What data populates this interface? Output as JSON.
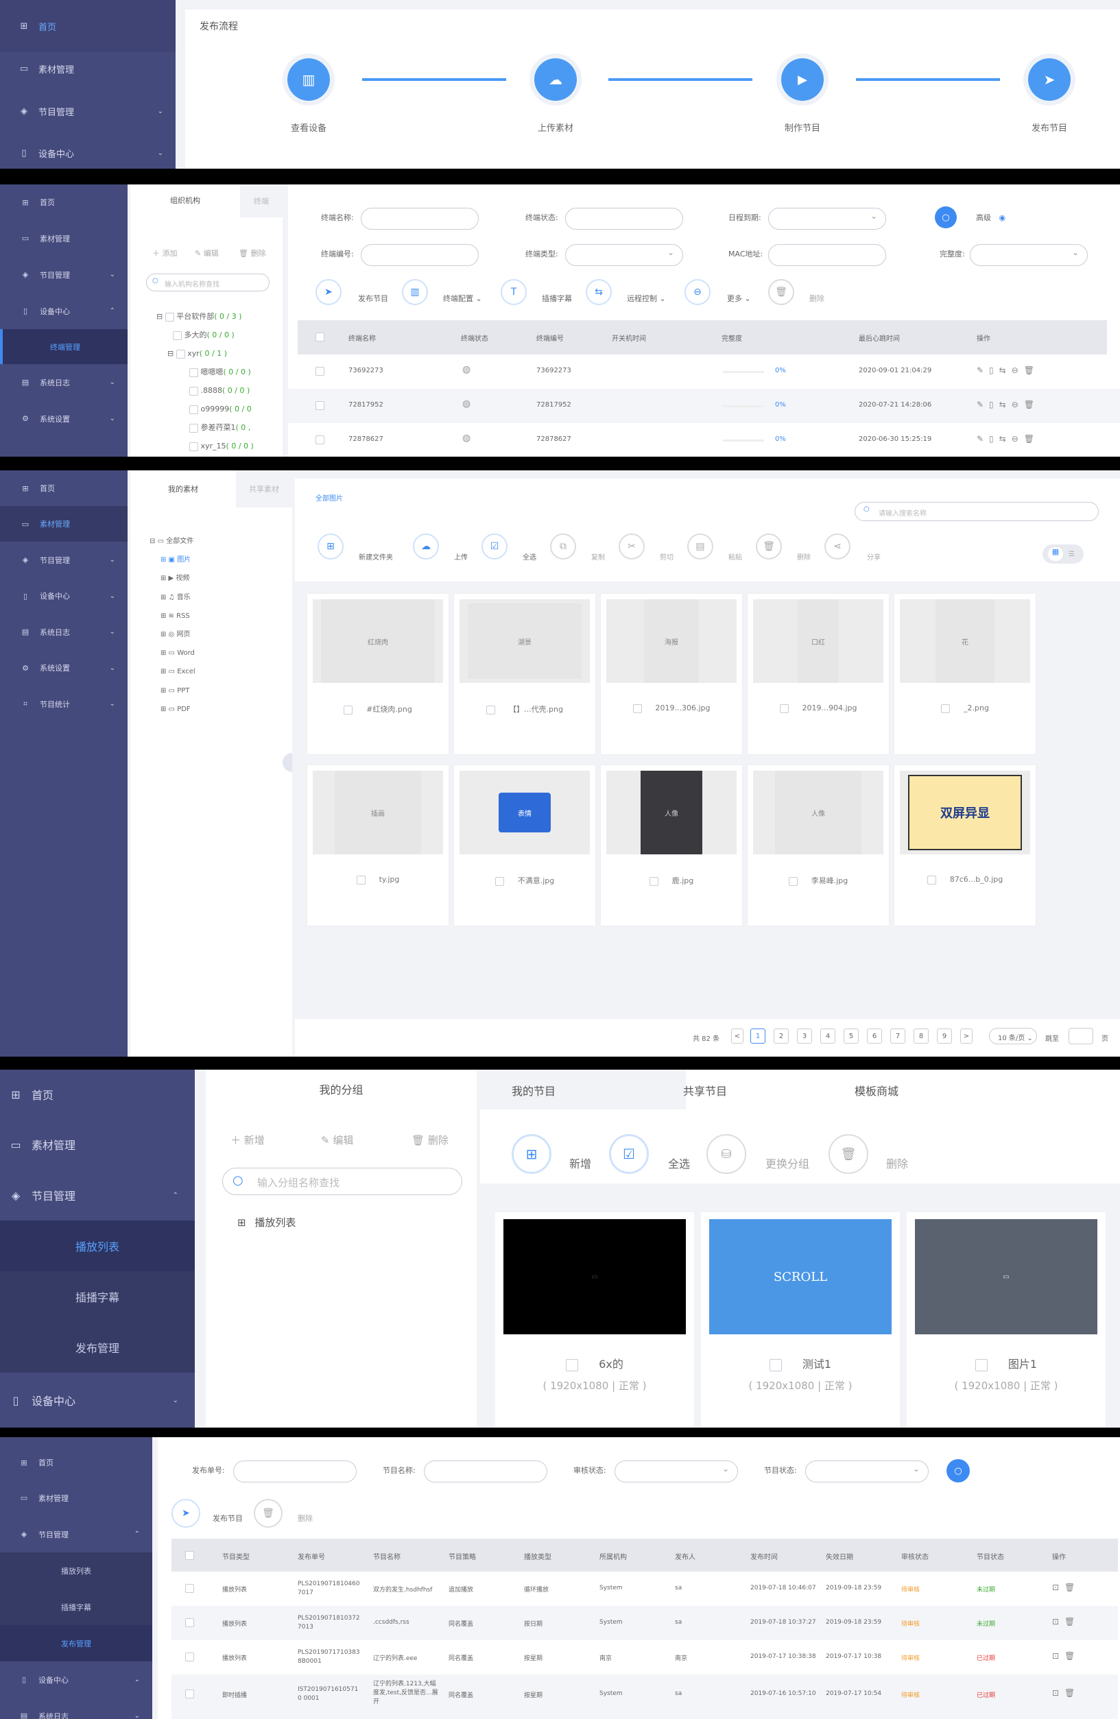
{
  "p1": {
    "sidebar": [
      "首页",
      "素材管理",
      "节目管理",
      "设备中心"
    ],
    "title": "发布流程",
    "steps": [
      "查看设备",
      "上传素材",
      "制作节目",
      "发布节目"
    ]
  },
  "p2": {
    "sidebar": [
      "首页",
      "素材管理",
      "节目管理",
      "设备中心",
      "终端管理",
      "系统日志",
      "系统设置"
    ],
    "tabs": [
      "组织机构",
      "终端"
    ],
    "tree_actions": [
      "添加",
      "编辑",
      "删除"
    ],
    "tree_search": "输入机构名称查找",
    "tree": [
      {
        "label": "平台软件部",
        "count": "( 0 / 3 )"
      },
      {
        "label": "多大的",
        "count": "( 0 / 0 )"
      },
      {
        "label": "xyr",
        "count": "( 0 / 1 )"
      },
      {
        "label": "嗯嗯嗯",
        "count": "( 0 / 0 )"
      },
      {
        "label": ".8888",
        "count": "( 0 / 0 )"
      },
      {
        "label": "o99999",
        "count": "( 0 / 0"
      },
      {
        "label": "参差荇菜1",
        "count": "( 0 ,"
      },
      {
        "label": "xyr_15",
        "count": "( 0 / 0 )"
      }
    ],
    "filters": [
      "终端名称:",
      "终端状态:",
      "日程到期:",
      "终端编号:",
      "终端类型:",
      "MAC地址:",
      "完整度:"
    ],
    "advanced": "高级",
    "actions": [
      "发布节目",
      "终端配置",
      "插播字幕",
      "远程控制",
      "更多",
      "删除"
    ],
    "columns": [
      "终端名称",
      "终端状态",
      "终端编号",
      "开关机时间",
      "完整度",
      "最后心跳时间",
      "操作"
    ],
    "rows": [
      {
        "name": "73692273",
        "no": "73692273",
        "pct": "0%",
        "time": "2020-09-01 21:04:29"
      },
      {
        "name": "72817952",
        "no": "72817952",
        "pct": "0%",
        "time": "2020-07-21 14:28:06"
      },
      {
        "name": "72878627",
        "no": "72878627",
        "pct": "0%",
        "time": "2020-06-30 15:25:19"
      }
    ]
  },
  "p3": {
    "sidebar": [
      "首页",
      "素材管理",
      "节目管理",
      "设备中心",
      "系统日志",
      "系统设置",
      "节目统计"
    ],
    "tabs": [
      "我的素材",
      "共享素材"
    ],
    "root": "全部文件",
    "types": [
      "图片",
      "视频",
      "音乐",
      "RSS",
      "网页",
      "Word",
      "Excel",
      "PPT",
      "PDF"
    ],
    "crumb": "全部图片",
    "search": "请输入搜索名称",
    "actions": [
      "新建文件夹",
      "上传",
      "全选",
      "复制",
      "剪切",
      "粘贴",
      "删除",
      "分享"
    ],
    "files": [
      {
        "name": "#红烧肉.png",
        "img": "红烧肉"
      },
      {
        "name": "【】...代壳.png",
        "img": "湖景"
      },
      {
        "name": "2019...306.jpg",
        "img": "海报"
      },
      {
        "name": "2019...904.jpg",
        "img": "口红"
      },
      {
        "name": "_2.png",
        "img": "花"
      },
      {
        "name": "ty.jpg",
        "img": "插画"
      },
      {
        "name": "不满意.jpg",
        "img": "表情"
      },
      {
        "name": "鹿.jpg",
        "img": "人像"
      },
      {
        "name": "李易峰.jpg",
        "img": "人像"
      },
      {
        "name": "87c6...b_0.jpg",
        "img": "双屏异显"
      }
    ],
    "pager": {
      "total": "共 82 条",
      "pages": [
        "1",
        "2",
        "3",
        "4",
        "5",
        "6",
        "7",
        "8",
        "9"
      ],
      "size": "10 条/页",
      "jump": "跳至",
      "unit": "页",
      "prev": "<",
      "next": ">"
    }
  },
  "p4": {
    "sidebar": [
      "首页",
      "素材管理",
      "节目管理",
      "播放列表",
      "插播字幕",
      "发布管理",
      "设备中心"
    ],
    "group_title": "我的分组",
    "group_actions": [
      "新增",
      "编辑",
      "删除"
    ],
    "group_search": "输入分组名称查找",
    "group_tree": "播放列表",
    "tabs": [
      "我的节目",
      "共享节目",
      "模板商城"
    ],
    "actions": [
      "新增",
      "全选",
      "更换分组",
      "删除"
    ],
    "cards": [
      {
        "name": "6x的",
        "meta": "( 1920x1080 | 正常 )"
      },
      {
        "name": "测试1",
        "meta": "( 1920x1080 | 正常 )"
      },
      {
        "name": "图片1",
        "meta": "( 1920x1080 | 正常 )"
      }
    ]
  },
  "p5": {
    "sidebar": [
      "首页",
      "素材管理",
      "节目管理",
      "播放列表",
      "插播字幕",
      "发布管理",
      "设备中心",
      "系统日志"
    ],
    "filters": [
      "发布单号:",
      "节目名称:",
      "审核状态:",
      "节目状态:"
    ],
    "actions": [
      "发布节目",
      "删除"
    ],
    "columns": [
      "节目类型",
      "发布单号",
      "节目名称",
      "节目策略",
      "播放类型",
      "所属机构",
      "发布人",
      "发布时间",
      "失效日期",
      "审核状态",
      "节目状态",
      "操作"
    ],
    "rows": [
      {
        "type": "播放列表",
        "no": "PLS20190718104607017",
        "name": "双方的发生.hsdhfhsf",
        "policy": "追加播放",
        "play": "循环播放",
        "org": "System",
        "user": "sa",
        "pub": "2019-07-18 10:46:07",
        "exp": "2019-09-18 23:59",
        "audit": "待审核",
        "state": "未过期"
      },
      {
        "type": "播放列表",
        "no": "PLS20190718103727013",
        "name": ".ccsddfs,rss",
        "policy": "同名覆盖",
        "play": "按日期",
        "org": "System",
        "user": "sa",
        "pub": "2019-07-18 10:37:27",
        "exp": "2019-09-18 23:59",
        "audit": "待审核",
        "state": "未过期"
      },
      {
        "type": "播放列表",
        "no": "PLS20190717103838B0001",
        "name": "辽宁的列表.eee",
        "policy": "同名覆盖",
        "play": "按星期",
        "org": "南京",
        "user": "南京",
        "pub": "2019-07-17 10:38:38",
        "exp": "2019-07-17 10:38",
        "audit": "待审核",
        "state": "已过期"
      },
      {
        "type": "即时插播",
        "no": "IST20190716105710 0001",
        "name": "辽宁的列表.1213,大幅度发,test,反馈是否...展开",
        "policy": "同名覆盖",
        "play": "按星期",
        "org": "System",
        "user": "sa",
        "pub": "2019-07-16 10:57:10",
        "exp": "2019-07-17 10:54",
        "audit": "待审核",
        "state": "已过期"
      }
    ]
  }
}
